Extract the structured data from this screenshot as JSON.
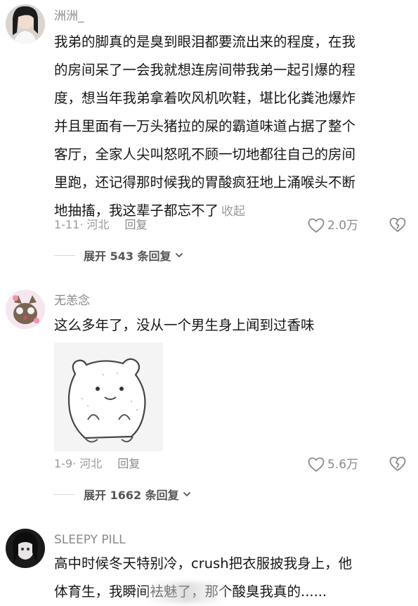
{
  "comments": [
    {
      "username": "洲洲_",
      "lines": [
        "我弟的脚真的是臭到眼泪都要流出来的程度，在我",
        "的房间呆了一会我就想连房间带我弟一起引爆的程",
        "度，想当年我弟拿着吹风机吹鞋，堪比化粪池爆炸",
        "并且里面有一万头猪拉的屎的霸道味道占据了整个",
        "客厅，全家人尖叫怒吼不顾一切地都往自己的房间",
        "里跑，还记得那时候我的胃酸疯狂地上涌喉头不断",
        "地抽搐，我这辈子都忘不了"
      ],
      "collapse_label": "收起",
      "date_location": "1-11· 河北",
      "reply_label": "回复",
      "likes": "2.0万",
      "expand_label": "展开 543 条回复"
    },
    {
      "username": "无恙念",
      "lines": [
        "这么多年了，没从一个男生身上闻到过香味"
      ],
      "date_location": "1-9· 河北",
      "reply_label": "回复",
      "likes": "5.6万",
      "expand_label": "展开 1662 条回复"
    },
    {
      "username": "SLEEPY PILL",
      "lines": [
        "高中时候冬天特别冷，crush把衣服披我身上，他",
        "体育生，我瞬间袪魅了，那个酸臭我真的......"
      ]
    }
  ],
  "icons": [
    "heart-outline-icon",
    "broken-heart-icon",
    "chevron-down-icon"
  ],
  "colors": {
    "text": "#161616",
    "secondary": "#9a9a9a",
    "divider": "#d8d8d8"
  }
}
